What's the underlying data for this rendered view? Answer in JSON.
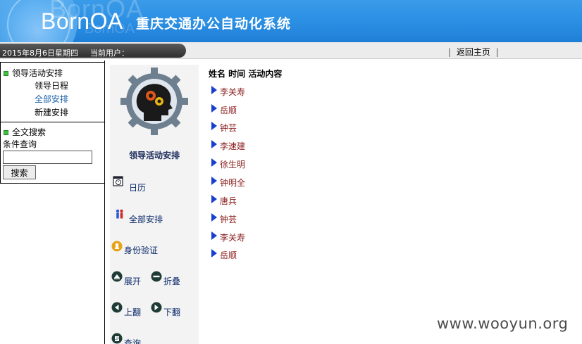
{
  "header": {
    "brand": "BornOA",
    "ghost_brand": "BornOA",
    "system_title": "重庆交通办公自动化系统",
    "bg_color": "#2a8ee3"
  },
  "statusbar": {
    "date": "2015年8月6日星期四",
    "current_user_label": "当前用户：",
    "sep_left": "|",
    "home_link": "返回主页",
    "sep_right": "|"
  },
  "left": {
    "section1": {
      "title": "领导活动安排",
      "items": [
        {
          "label": "领导日程",
          "active": false
        },
        {
          "label": "全部安排",
          "active": true
        },
        {
          "label": "新建安排",
          "active": false
        }
      ]
    },
    "section2": {
      "title": "全文搜索",
      "condition_label": "条件查询",
      "search_value": "",
      "search_button": "搜索"
    }
  },
  "middle": {
    "title": "领导活动安排",
    "menu": {
      "calendar": "日历",
      "all_schedule": "全部安排",
      "identity": "身份验证",
      "expand": "展开",
      "collapse": "折叠",
      "page_up": "上翻",
      "page_down": "下翻",
      "query": "查询"
    }
  },
  "main": {
    "header": "姓名 时间 活动内容",
    "rows": [
      "李关寿",
      "岳顺",
      "钟芸",
      "李速建",
      "徐生明",
      "钟明全",
      "唐兵",
      "钟芸",
      "李关寿",
      "岳顺"
    ],
    "arrow_color": "#1a3fd0",
    "name_color": "#8a1c1c"
  },
  "watermark": "www.wooyun.org"
}
